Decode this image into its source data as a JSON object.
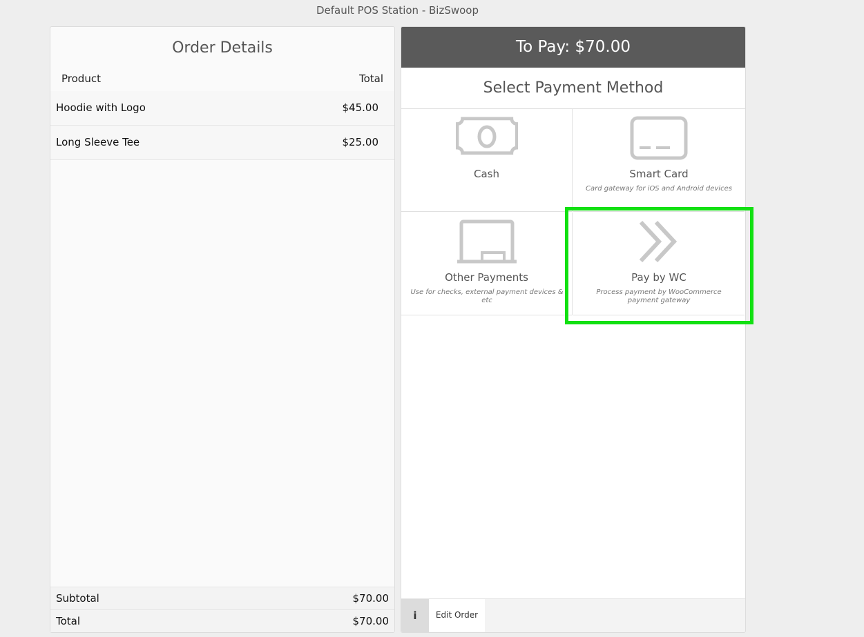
{
  "window": {
    "title": "Default POS Station - BizSwoop"
  },
  "order": {
    "title": "Order Details",
    "columns": {
      "product": "Product",
      "total": "Total"
    },
    "items": [
      {
        "name": "Hoodie with Logo",
        "price": "$45.00"
      },
      {
        "name": "Long Sleeve Tee",
        "price": "$25.00"
      }
    ],
    "subtotal_label": "Subtotal",
    "subtotal_value": "$70.00",
    "total_label": "Total",
    "total_value": "$70.00"
  },
  "payment": {
    "to_pay": "To Pay: $70.00",
    "select_title": "Select Payment Method",
    "methods": [
      {
        "name": "Cash",
        "description": "",
        "icon": "cash-icon"
      },
      {
        "name": "Smart Card",
        "description": "Card gateway for iOS and Android devices",
        "icon": "smart-card-icon"
      },
      {
        "name": "Other Payments",
        "description": "Use for checks, external payment devices & etc",
        "icon": "terminal-icon"
      },
      {
        "name": "Pay by WC",
        "description": "Process payment by WooCommerce payment gateway",
        "icon": "double-chevron-right-icon"
      }
    ],
    "info_label": "i",
    "edit_order_label": "Edit Order"
  },
  "colors": {
    "header_bg": "#5a5a5a",
    "highlight": "#11e011",
    "icon": "#c8c8c8"
  }
}
